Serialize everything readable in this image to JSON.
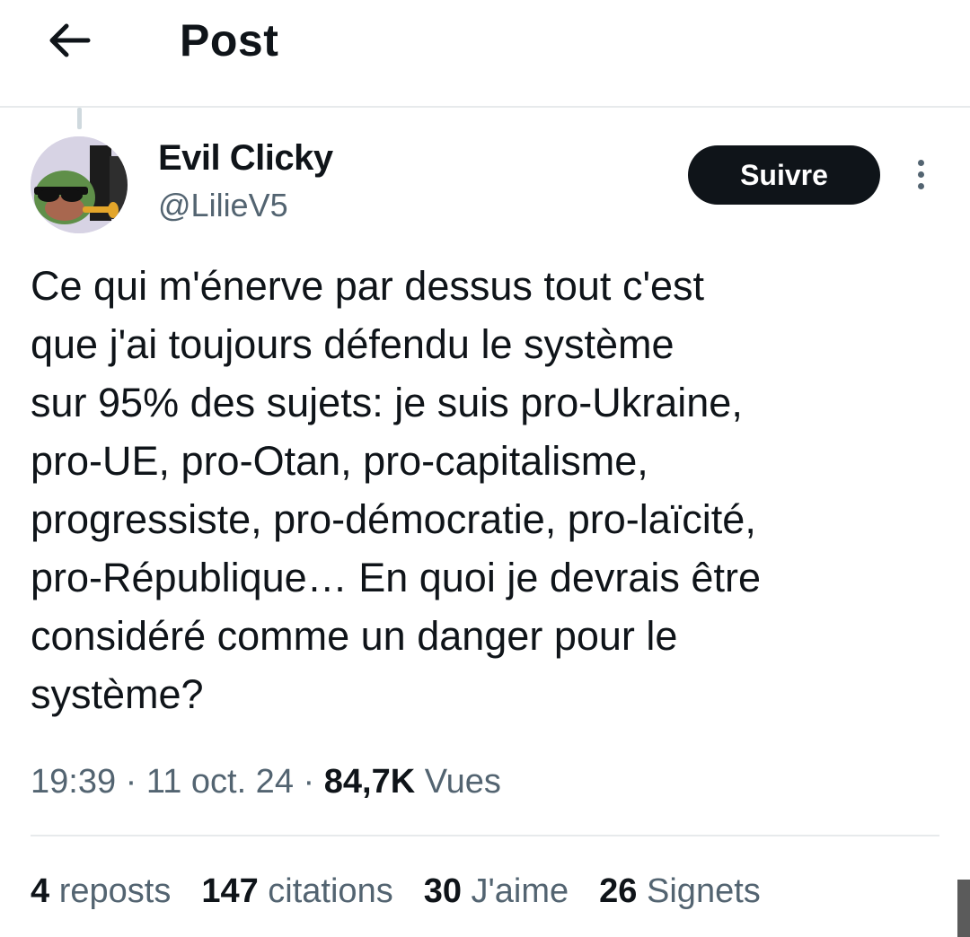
{
  "header": {
    "back_icon": "arrow-left-icon",
    "title": "Post"
  },
  "author": {
    "display_name": "Evil Clicky",
    "handle": "@LilieV5",
    "avatar": "avatar-frog-sunglasses-trumpet"
  },
  "follow_label": "Suivre",
  "more_icon": "vertical-ellipsis-icon",
  "post": {
    "text": "Ce qui m'énerve par dessus tout c'est\nque j'ai toujours défendu le système\nsur 95% des sujets: je suis pro-Ukraine,\npro-UE, pro-Otan, pro-capitalisme,\nprogressiste, pro-démocratie, pro-laïcité,\npro-République… En quoi je devrais être\nconsidéré comme un danger pour le\nsystème?",
    "time": "19:39",
    "sep": " · ",
    "date": "11 oct. 24",
    "views_count": "84,7K",
    "views_label": "Vues"
  },
  "stats": [
    {
      "count": "4",
      "label": "reposts"
    },
    {
      "count": "147",
      "label": "citations"
    },
    {
      "count": "30",
      "label": "J'aime"
    },
    {
      "count": "26",
      "label": "Signets"
    }
  ],
  "colors": {
    "text": "#0f1419",
    "secondary": "#536471",
    "divider": "#e7eaec",
    "button_bg": "#0f1419"
  }
}
